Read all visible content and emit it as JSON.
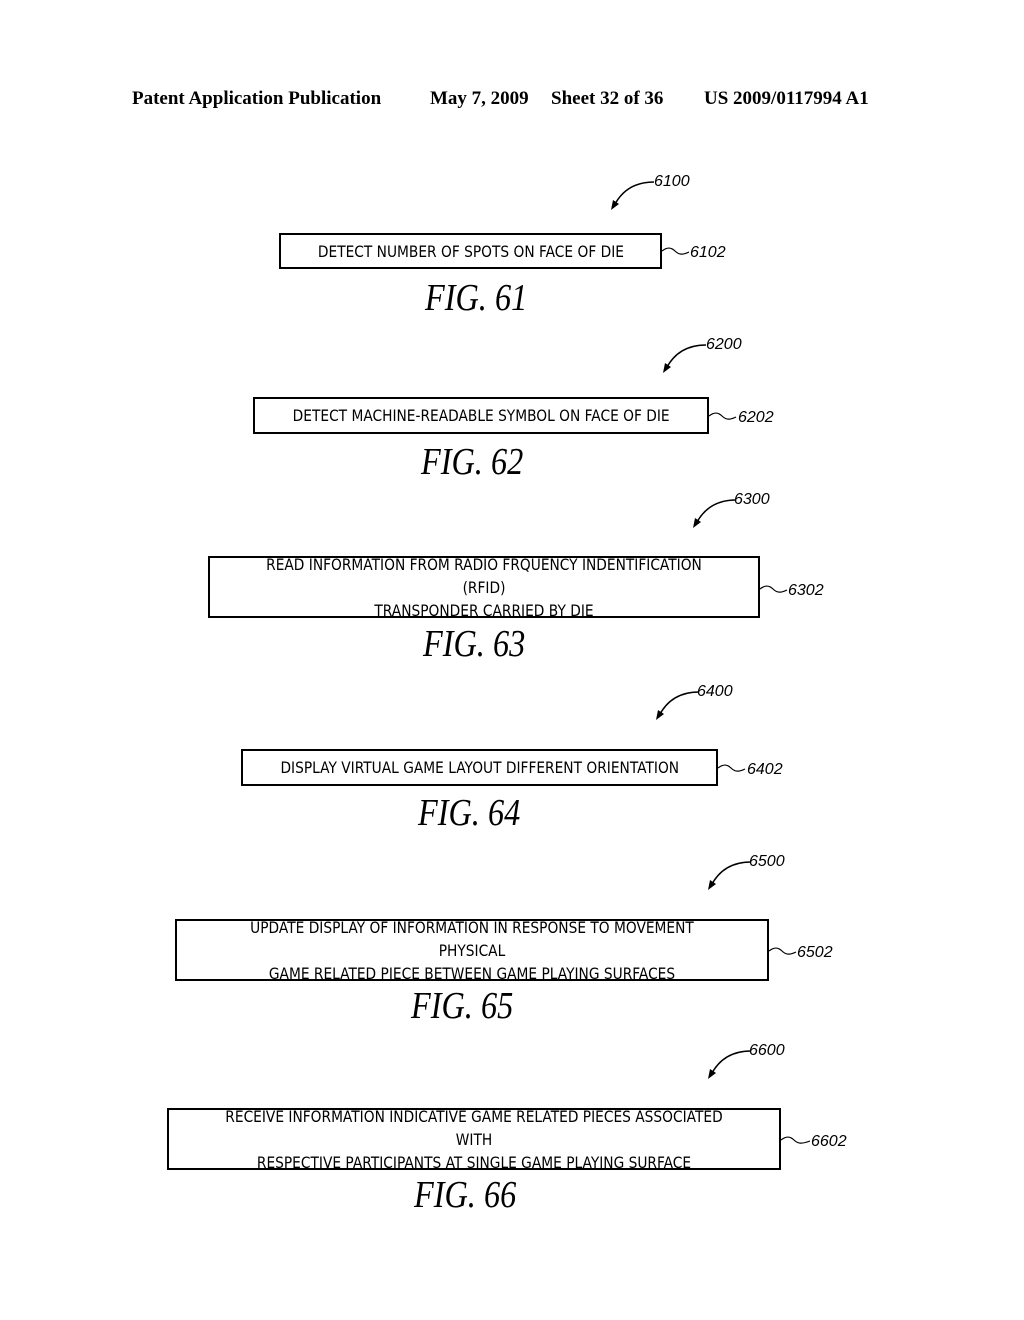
{
  "header": {
    "left": "Patent Application Publication",
    "date": "May 7, 2009",
    "sheet": "Sheet 32 of 36",
    "number": "US 2009/0117994 A1"
  },
  "figures": [
    {
      "id": "61",
      "label": "FIG. 61",
      "figure_ref": "6100",
      "step_ref": "6102",
      "text": "DETECT NUMBER OF SPOTS ON FACE OF DIE"
    },
    {
      "id": "62",
      "label": "FIG. 62",
      "figure_ref": "6200",
      "step_ref": "6202",
      "text": "DETECT MACHINE-READABLE SYMBOL ON FACE OF DIE"
    },
    {
      "id": "63",
      "label": "FIG. 63",
      "figure_ref": "6300",
      "step_ref": "6302",
      "text": "READ INFORMATION FROM RADIO FRQUENCY INDENTIFICATION (RFID)\nTRANSPONDER CARRIED BY DIE"
    },
    {
      "id": "64",
      "label": "FIG. 64",
      "figure_ref": "6400",
      "step_ref": "6402",
      "text": "DISPLAY VIRTUAL GAME LAYOUT DIFFERENT ORIENTATION"
    },
    {
      "id": "65",
      "label": "FIG. 65",
      "figure_ref": "6500",
      "step_ref": "6502",
      "text": "UPDATE DISPLAY OF INFORMATION IN RESPONSE TO MOVEMENT PHYSICAL\nGAME RELATED PIECE BETWEEN GAME PLAYING SURFACES"
    },
    {
      "id": "66",
      "label": "FIG. 66",
      "figure_ref": "6600",
      "step_ref": "6602",
      "text": "RECEIVE INFORMATION INDICATIVE GAME RELATED PIECES ASSOCIATED WITH\nRESPECTIVE PARTICIPANTS AT SINGLE GAME PLAYING SURFACE"
    }
  ]
}
